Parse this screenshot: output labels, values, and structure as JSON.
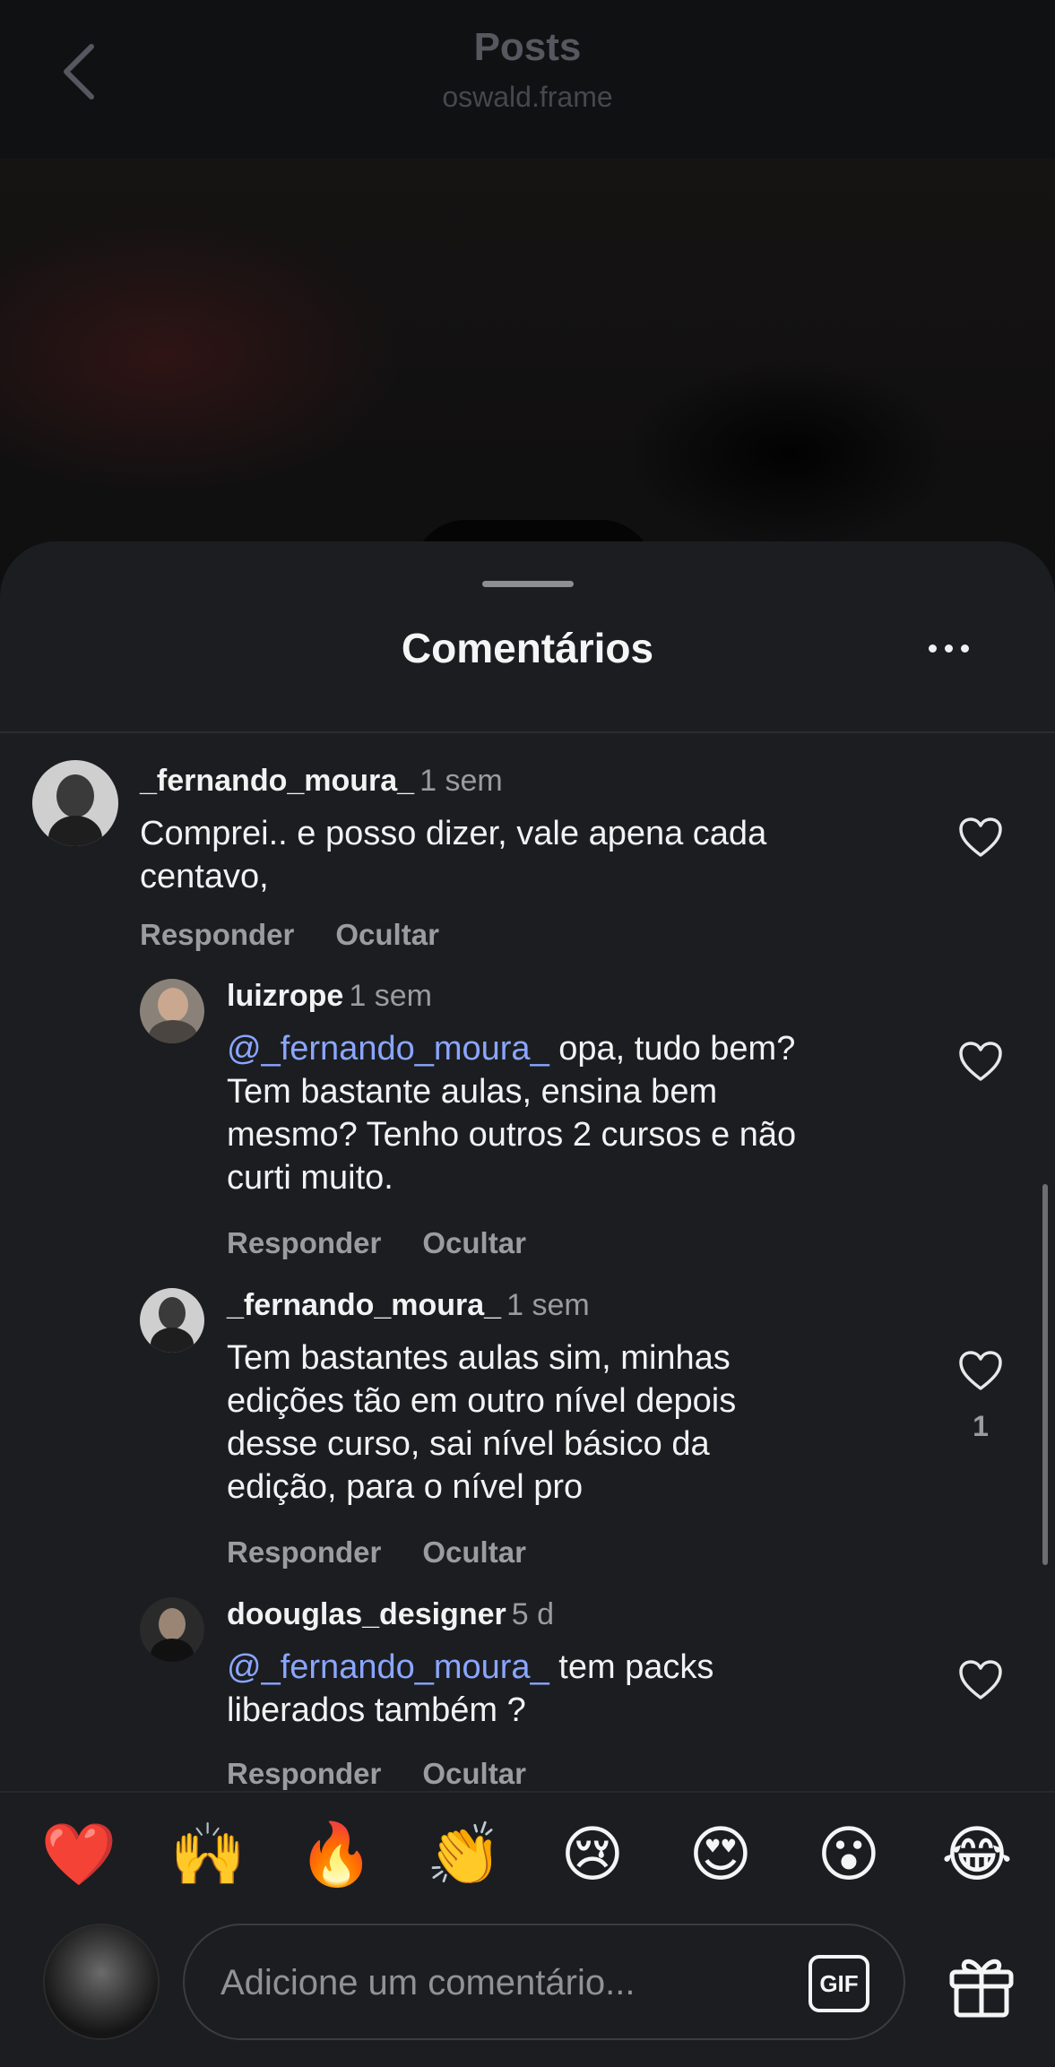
{
  "header": {
    "title": "Posts",
    "subtitle": "oswald.frame",
    "back_icon": "chevron-left-icon"
  },
  "sheet": {
    "title": "Comentários",
    "more_icon": "more-horizontal-icon"
  },
  "comments": [
    {
      "username": "_fernando_moura_",
      "time": "1 sem",
      "mention": "",
      "text_lines": [
        "Comprei.. e posso dizer, vale apena cada",
        "centavo,"
      ],
      "reply": "Responder",
      "hide": "Ocultar",
      "like_count": ""
    },
    {
      "username": "luizrope",
      "time": "1 sem",
      "mention": "@_fernando_moura_",
      "text_lines": [
        " opa, tudo bem?",
        "Tem bastante aulas, ensina bem",
        "mesmo? Tenho outros 2 cursos e não",
        "curti muito."
      ],
      "reply": "Responder",
      "hide": "Ocultar",
      "like_count": ""
    },
    {
      "username": "_fernando_moura_",
      "time": "1 sem",
      "mention": "",
      "text_lines": [
        "Tem bastantes aulas sim, minhas",
        "edições tão em outro nível depois",
        "desse curso, sai nível básico da",
        "edição, para o nível  pro"
      ],
      "reply": "Responder",
      "hide": "Ocultar",
      "like_count": "1"
    },
    {
      "username": "doouglas_designer",
      "time": "5 d",
      "mention": "@_fernando_moura_",
      "text_lines": [
        " tem packs",
        "liberados também ?"
      ],
      "reply": "Responder",
      "hide": "Ocultar",
      "like_count": ""
    }
  ],
  "emoji_bar": [
    "❤️",
    "🙌",
    "🔥",
    "👏",
    "😢",
    "😍",
    "😮",
    "😂"
  ],
  "composer": {
    "placeholder": "Adicione um comentário...",
    "gif_label": "GIF",
    "gift_icon": "gift-icon"
  }
}
